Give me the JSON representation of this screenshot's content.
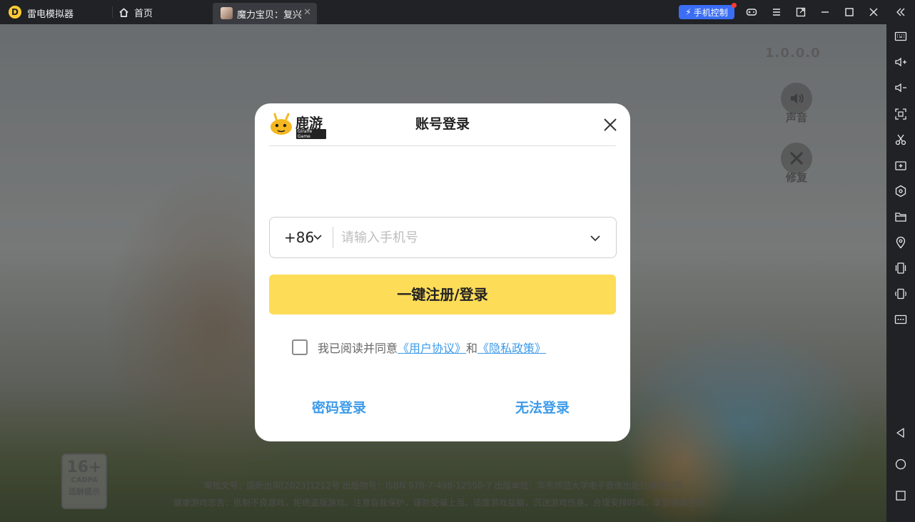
{
  "titlebar": {
    "app_name": "雷电模拟器",
    "home_tab": "首页",
    "game_tab": "魔力宝贝：复兴",
    "phone_control": "手机控制"
  },
  "game": {
    "version": "1.0.0.0",
    "sound_label": "声音",
    "repair_label": "修复",
    "age_rating": "16+",
    "age_org": "CADPA",
    "age_tip": "适龄提示",
    "notice_line1": "审批文号：国新出审[2023]1212号  出版物号：ISBN 978-7-498-12550-7  出版单位：华东师范大学电子音像出版社有限公司",
    "notice_line2": "健康游戏忠告：抵制不良游戏，拒绝盗版游戏。注意自我保护，谨防受骗上当。适度游戏益脑，沉迷游戏伤身。合理安排时间，享受健康生活。"
  },
  "dialog": {
    "brand": "鹿游",
    "brand_sub": "Giraffe Game",
    "title": "账号登录",
    "country_code": "+86",
    "phone_placeholder": "请输入手机号",
    "login_button": "一键注册/登录",
    "agree_prefix": "我已阅读并同意",
    "user_agreement": "《用户协议》",
    "and": "和",
    "privacy_policy": "《隐私政策》",
    "password_login": "密码登录",
    "cannot_login": "无法登录"
  },
  "colors": {
    "accent_blue": "#3b6ef5",
    "login_yellow": "#fddc58",
    "link_blue": "#3d9be9"
  }
}
